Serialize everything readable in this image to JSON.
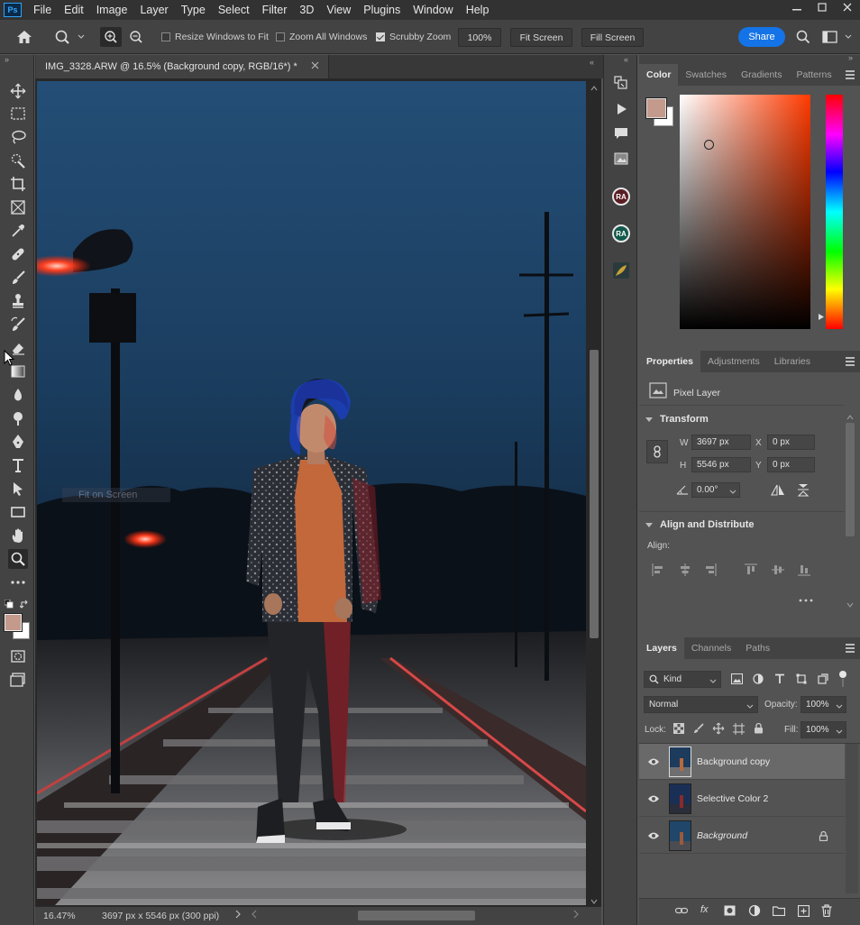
{
  "app": {
    "logo": "Ps"
  },
  "menu": [
    "File",
    "Edit",
    "Image",
    "Layer",
    "Type",
    "Select",
    "Filter",
    "3D",
    "View",
    "Plugins",
    "Window",
    "Help"
  ],
  "window_controls": [
    "minimize-icon",
    "maximize-icon",
    "close-icon"
  ],
  "options_bar": {
    "resize_windows": {
      "label": "Resize Windows to Fit",
      "checked": false
    },
    "zoom_all_windows": {
      "label": "Zoom All Windows",
      "checked": false
    },
    "scrubby_zoom": {
      "label": "Scrubby Zoom",
      "checked": true
    },
    "zoom_level": "100%",
    "fit_screen": "Fit Screen",
    "fill_screen": "Fill Screen",
    "share": "Share"
  },
  "document": {
    "tab_title": "IMG_3328.ARW @ 16.5% (Background copy, RGB/16*) *",
    "tooltip": "Fit on Screen",
    "status_zoom": "16.47%",
    "status_info": "3697 px x 5546 px (300 ppi)"
  },
  "color_panel": {
    "tabs": [
      "Color",
      "Swatches",
      "Gradients",
      "Patterns"
    ],
    "foreground_color": "#c49a8c",
    "background_color": "#ffffff",
    "base_hue_color": "#ff3a00"
  },
  "properties_panel": {
    "tabs": [
      "Properties",
      "Adjustments",
      "Libraries"
    ],
    "layer_type": "Pixel Layer",
    "transform": {
      "title": "Transform",
      "w_label": "W",
      "w": "3697 px",
      "h_label": "H",
      "h": "5546 px",
      "x_label": "X",
      "x": "0 px",
      "y_label": "Y",
      "y": "0 px",
      "angle": "0.00°"
    },
    "align": {
      "title": "Align and Distribute",
      "align_label": "Align:"
    }
  },
  "layers_panel": {
    "tabs": [
      "Layers",
      "Channels",
      "Paths"
    ],
    "filter_kind": "Kind",
    "blend_mode": "Normal",
    "opacity_label": "Opacity:",
    "opacity": "100%",
    "lock_label": "Lock:",
    "fill_label": "Fill:",
    "fill": "100%",
    "layers": [
      {
        "name": "Background copy",
        "selected": true,
        "locked": false,
        "italic": false
      },
      {
        "name": "Selective Color 2",
        "selected": false,
        "locked": false,
        "italic": false
      },
      {
        "name": "Background",
        "selected": false,
        "locked": true,
        "italic": true
      }
    ]
  }
}
